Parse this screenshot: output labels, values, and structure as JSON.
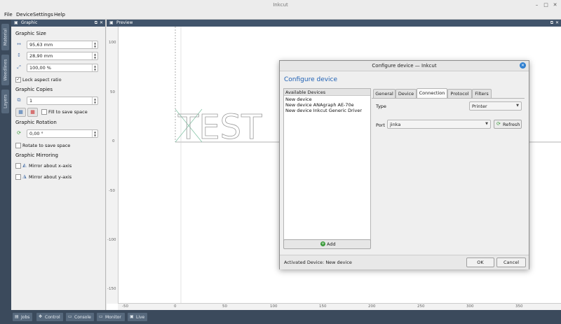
{
  "window": {
    "title": "Inkcut"
  },
  "menu": [
    "File",
    "Device",
    "Settings",
    "Help"
  ],
  "side_tabs": [
    "Material",
    "Weedlines",
    "Layers"
  ],
  "graphic_panel": {
    "title": "Graphic",
    "size_label": "Graphic Size",
    "width_value": "95,63 mm",
    "height_value": "28,90 mm",
    "scale_value": "100,00 %",
    "lock_aspect_label": "Lock aspect ratio",
    "lock_aspect_checked": true,
    "copies_label": "Graphic Copies",
    "copies_value": "1",
    "fill_label": "Fill to save space",
    "rotation_label": "Graphic Rotation",
    "rotation_value": "0,00 °",
    "rotate_label": "Rotate to save space",
    "mirroring_label": "Graphic Mirroring",
    "mirror_x_label": "Mirror about x-axis",
    "mirror_y_label": "Mirror about y-axis"
  },
  "preview": {
    "title": "Preview",
    "graphic_text": "TEST",
    "y_ticks": [
      "100",
      "50",
      "0",
      "-50",
      "-100",
      "-150"
    ],
    "x_ticks": [
      "-50",
      "0",
      "50",
      "100",
      "150",
      "200",
      "250",
      "300",
      "350"
    ]
  },
  "bottom_tabs": [
    "Jobs",
    "Control",
    "Console",
    "Monitor",
    "Live"
  ],
  "dialog": {
    "title": "Configure device — Inkcut",
    "heading": "Configure device",
    "list_header": "Available Devices",
    "devices": [
      "New device",
      "New device ANAgraph AE-70e",
      "New device Inkcut Generic Driver"
    ],
    "add_label": "Add",
    "tabs": [
      "General",
      "Device",
      "Connection",
      "Protocol",
      "Filters"
    ],
    "active_tab": "Connection",
    "type_label": "Type",
    "type_value": "Printer",
    "port_label": "Port",
    "port_value": "jinka",
    "refresh_label": "Refresh",
    "activated_text": "Activated Device: New device",
    "ok_label": "OK",
    "cancel_label": "Cancel"
  },
  "colors": {
    "accent": "#1d5fb4",
    "panel_header": "#41546b",
    "sidebar": "#3b4a5c"
  }
}
